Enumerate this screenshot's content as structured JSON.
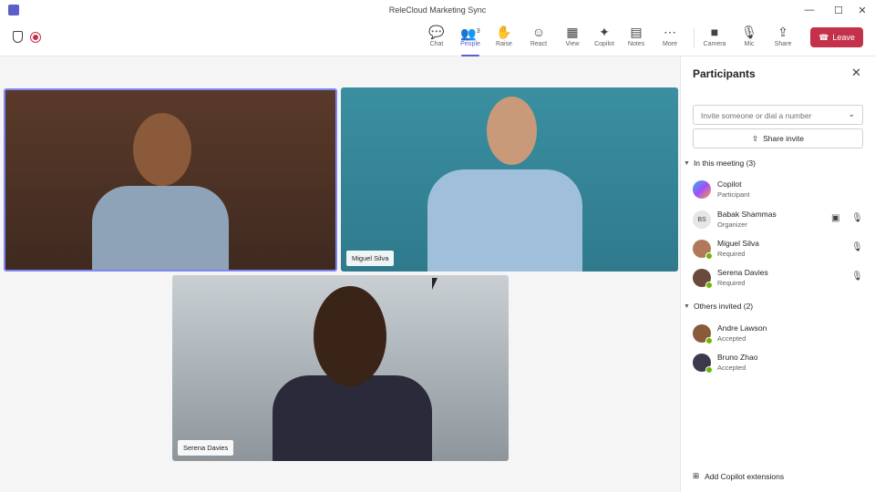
{
  "window": {
    "title": "ReleCloud Marketing Sync",
    "minimize": "—",
    "maximize": "☐",
    "close": "✕"
  },
  "toolbar": {
    "buttons": [
      {
        "label": "Chat",
        "icon": "chat-icon"
      },
      {
        "label": "People",
        "icon": "people-icon",
        "count": "3",
        "active": true
      },
      {
        "label": "Raise",
        "icon": "hand-icon"
      },
      {
        "label": "React",
        "icon": "smiley-icon"
      },
      {
        "label": "View",
        "icon": "grid-icon"
      },
      {
        "label": "Copilot",
        "icon": "copilot-icon"
      },
      {
        "label": "Notes",
        "icon": "notes-icon"
      },
      {
        "label": "More",
        "icon": "ellipsis-icon"
      },
      {
        "label": "Camera",
        "icon": "camera-icon"
      },
      {
        "label": "Mic",
        "icon": "mic-icon"
      },
      {
        "label": "Share",
        "icon": "share-icon"
      }
    ],
    "leave_label": "Leave"
  },
  "tiles": [
    {
      "name": ""
    },
    {
      "name": "Miguel Silva"
    },
    {
      "name": "Serena Davies"
    }
  ],
  "panel": {
    "title": "Participants",
    "invite_placeholder": "Invite someone or dial a number",
    "share_invite_label": "Share invite",
    "in_meeting_header": "In this meeting (3)",
    "in_meeting": [
      {
        "name": "Copilot",
        "role": "Participant"
      },
      {
        "name": "Babak Shammas",
        "role": "Organizer",
        "initials": "BS"
      },
      {
        "name": "Miguel Silva",
        "role": "Required"
      },
      {
        "name": "Serena Davies",
        "role": "Required"
      }
    ],
    "others_header": "Others invited (2)",
    "others": [
      {
        "name": "Andre Lawson",
        "role": "Accepted"
      },
      {
        "name": "Bruno Zhao",
        "role": "Accepted"
      }
    ],
    "add_extensions_label": "Add Copilot extensions"
  },
  "colors": {
    "accent": "#5b5fc7",
    "leave": "#c4314b",
    "presence": "#6bb700"
  }
}
